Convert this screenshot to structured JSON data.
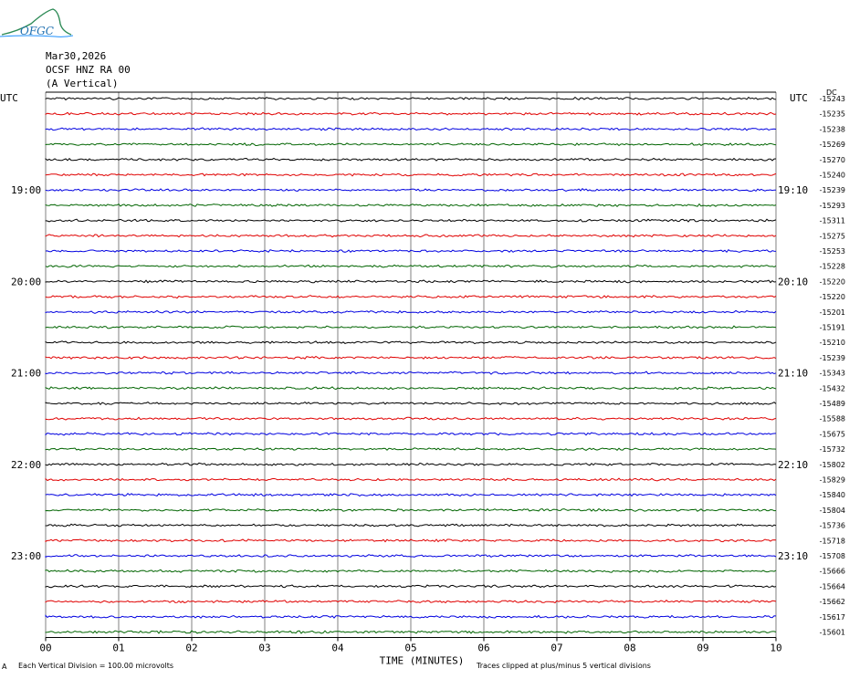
{
  "logo_text": "OFGC",
  "header": {
    "date": "Mar30,2026",
    "station": "OCSF HNZ RA 00",
    "component": "(A Vertical)"
  },
  "left_axis_title": "UTC",
  "right_axis_title": "UTC",
  "offset_top_label": "DC",
  "footer": {
    "scale_note": "Each Vertical Division =  100.00 microvolts",
    "clip_note": "Traces clipped at plus/minus 5 vertical divisions",
    "mark": "A"
  },
  "colors": {
    "trace_cycle": [
      "#000000",
      "#e00000",
      "#0000e0",
      "#006400"
    ],
    "grid": "#808080"
  },
  "chart_data": {
    "type": "line",
    "title": "Mar30,2026 OCSF HNZ RA 00 (A Vertical)",
    "xlabel": "TIME (MINUTES)",
    "ylabel": "UTC",
    "xlim": [
      0,
      10
    ],
    "x_ticks": [
      "00",
      "01",
      "02",
      "03",
      "04",
      "05",
      "06",
      "07",
      "08",
      "09",
      "10"
    ],
    "left_time_labels": [
      {
        "row": 6,
        "text": "19:00"
      },
      {
        "row": 12,
        "text": "20:00"
      },
      {
        "row": 18,
        "text": "21:00"
      },
      {
        "row": 24,
        "text": "22:00"
      },
      {
        "row": 30,
        "text": "23:00"
      }
    ],
    "right_time_labels": [
      {
        "row": 6,
        "text": "19:10"
      },
      {
        "row": 12,
        "text": "20:10"
      },
      {
        "row": 18,
        "text": "21:10"
      },
      {
        "row": 24,
        "text": "22:10"
      },
      {
        "row": 30,
        "text": "23:10"
      }
    ],
    "trace_offsets": [
      -15243,
      -15235,
      -15238,
      -15269,
      -15270,
      -15240,
      -15239,
      -15293,
      -15311,
      -15275,
      -15253,
      -15228,
      -15220,
      -15220,
      -15201,
      -15191,
      -15210,
      -15239,
      -15343,
      -15432,
      -15489,
      -15588,
      -15675,
      -15732,
      -15802,
      -15829,
      -15840,
      -15804,
      -15736,
      -15718,
      -15708,
      -15666,
      -15664,
      -15662,
      -15617,
      -15601
    ],
    "grid": true
  }
}
